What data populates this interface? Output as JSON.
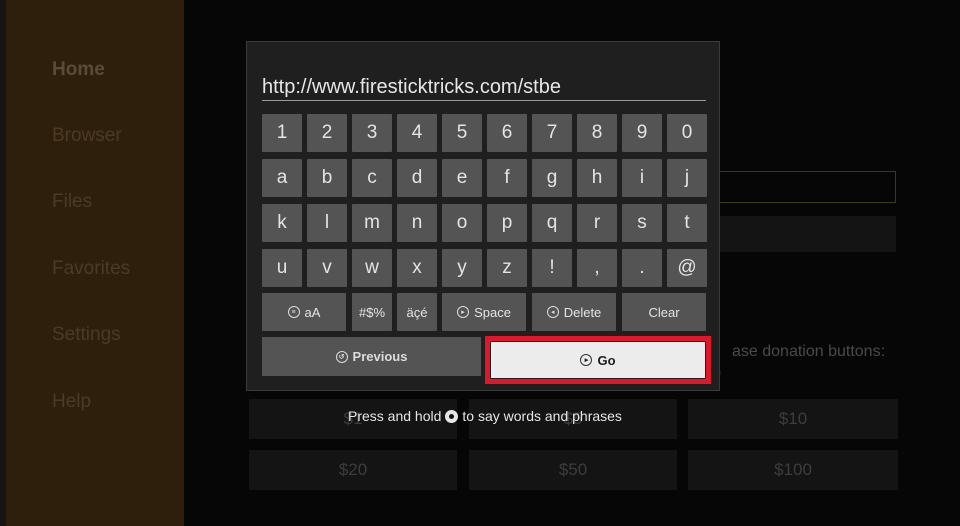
{
  "sidebar": {
    "items": [
      {
        "label": "Home"
      },
      {
        "label": "Browser"
      },
      {
        "label": "Files"
      },
      {
        "label": "Favorites"
      },
      {
        "label": "Settings"
      },
      {
        "label": "Help"
      }
    ]
  },
  "background": {
    "donation_text": "ase donation buttons:",
    "donation_text_2": ")",
    "donations": [
      "$1",
      "$5",
      "$10",
      "$20",
      "$50",
      "$100"
    ]
  },
  "keyboard": {
    "url_value": "http://www.firesticktricks.com/stbe",
    "rows": [
      [
        "1",
        "2",
        "3",
        "4",
        "5",
        "6",
        "7",
        "8",
        "9",
        "0"
      ],
      [
        "a",
        "b",
        "c",
        "d",
        "e",
        "f",
        "g",
        "h",
        "i",
        "j"
      ],
      [
        "k",
        "l",
        "m",
        "n",
        "o",
        "p",
        "q",
        "r",
        "s",
        "t"
      ],
      [
        "u",
        "v",
        "w",
        "x",
        "y",
        "z",
        "!",
        ",",
        ".",
        "@"
      ]
    ],
    "function_keys": {
      "case": "aA",
      "symbols": "#$%",
      "accents": "äçé",
      "space": "Space",
      "delete": "Delete",
      "clear": "Clear"
    },
    "previous_label": "Previous",
    "go_label": "Go",
    "hint_before": "Press and hold",
    "hint_after": "to say words and phrases",
    "highlight_color": "#e0162b"
  }
}
